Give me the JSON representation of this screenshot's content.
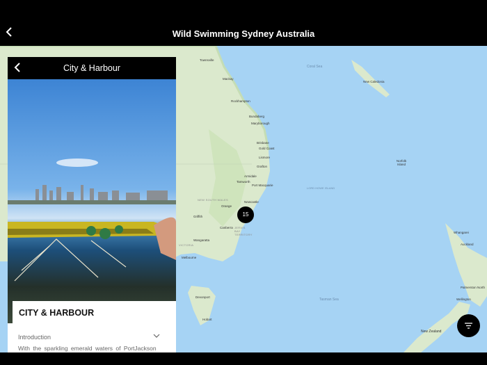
{
  "header": {
    "title": "Wild Swimming Sydney Australia",
    "back_icon": "chevron-left-icon"
  },
  "map": {
    "cluster_count": "15",
    "colors": {
      "sea": "#a6d3f4",
      "land": "#dbe9cd"
    },
    "labels": [
      {
        "text": "Townsville",
        "kind": "city"
      },
      {
        "text": "Mackay",
        "kind": "city"
      },
      {
        "text": "Rockhampton",
        "kind": "city"
      },
      {
        "text": "Bundaberg",
        "kind": "city"
      },
      {
        "text": "Maryborough",
        "kind": "city"
      },
      {
        "text": "Brisbane",
        "kind": "city"
      },
      {
        "text": "Gold Coast",
        "kind": "city"
      },
      {
        "text": "Lismore",
        "kind": "city"
      },
      {
        "text": "Grafton",
        "kind": "city"
      },
      {
        "text": "Armidale",
        "kind": "city"
      },
      {
        "text": "Tamworth",
        "kind": "city"
      },
      {
        "text": "Port Macquarie",
        "kind": "city"
      },
      {
        "text": "Newcastle",
        "kind": "city"
      },
      {
        "text": "Orange",
        "kind": "city"
      },
      {
        "text": "Griffith",
        "kind": "city"
      },
      {
        "text": "Canberra",
        "kind": "city"
      },
      {
        "text": "Wangaratta",
        "kind": "city"
      },
      {
        "text": "Melbourne",
        "kind": "city"
      },
      {
        "text": "Devonport",
        "kind": "city"
      },
      {
        "text": "Hobart",
        "kind": "city"
      },
      {
        "text": "NEW SOUTH WALES",
        "kind": "reg"
      },
      {
        "text": "VICTORIA",
        "kind": "reg"
      },
      {
        "text": "JERVIS BAY TERRITORY",
        "kind": "reg"
      },
      {
        "text": "Coral Sea",
        "kind": "sea"
      },
      {
        "text": "New Caledonia",
        "kind": "city"
      },
      {
        "text": "Norfolk Island",
        "kind": "city"
      },
      {
        "text": "LORD HOWE ISLAND",
        "kind": "sea"
      },
      {
        "text": "Tasman Sea",
        "kind": "sea"
      },
      {
        "text": "Whangarei",
        "kind": "city"
      },
      {
        "text": "Auckland",
        "kind": "city"
      },
      {
        "text": "Palmerston North",
        "kind": "city"
      },
      {
        "text": "Wellington",
        "kind": "city"
      },
      {
        "text": "New Zealand",
        "kind": "city"
      }
    ]
  },
  "panel": {
    "title": "City &  Harbour",
    "card_title": "CITY &  HARBOUR",
    "section_label": "Introduction",
    "intro_text": "With the sparkling emerald waters of PortJackson"
  },
  "filter_button": {
    "icon": "filter-icon"
  }
}
